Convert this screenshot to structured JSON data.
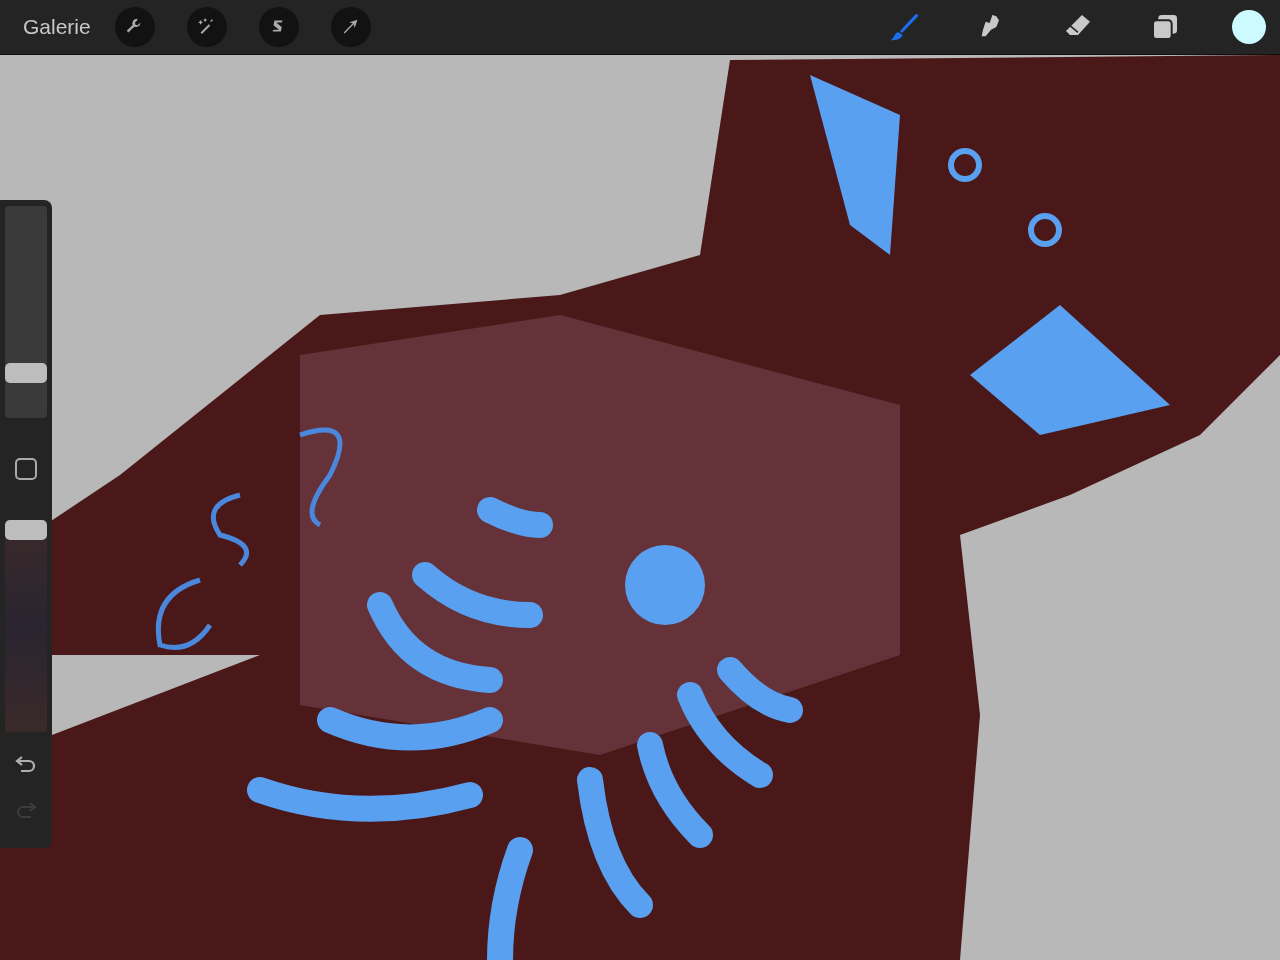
{
  "toolbar": {
    "gallery": "Galerie",
    "actions": [
      {
        "kind": "wrench"
      },
      {
        "kind": "wand"
      },
      {
        "kind": "selection"
      },
      {
        "kind": "transform"
      }
    ],
    "tools": [
      {
        "kind": "brush",
        "selected": true
      },
      {
        "kind": "smudge",
        "selected": false
      },
      {
        "kind": "eraser",
        "selected": false
      },
      {
        "kind": "layers",
        "selected": false
      }
    ],
    "color": "#ccfaff"
  },
  "sidebar": {
    "sliders": [
      {
        "kind": "size",
        "level": 0.18
      },
      {
        "kind": "opacity",
        "level": 1
      }
    ],
    "undo": {
      "disabled": false
    },
    "redo": {
      "disabled": true
    }
  }
}
